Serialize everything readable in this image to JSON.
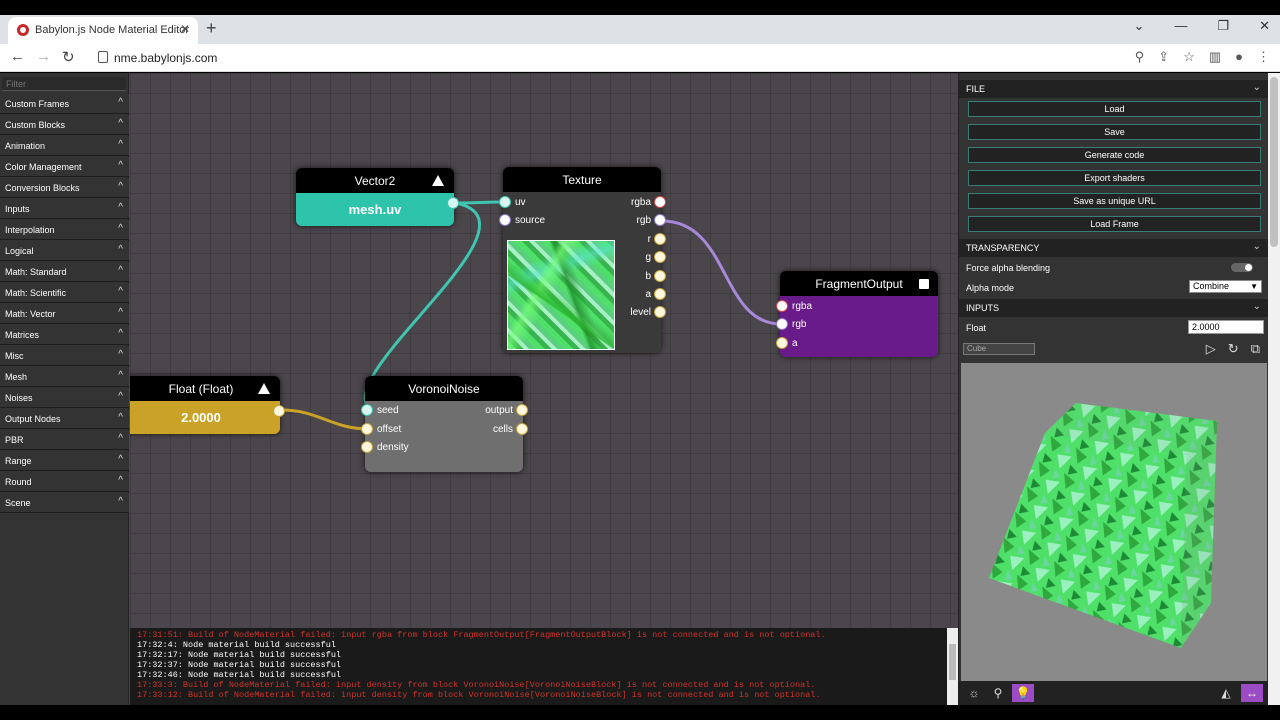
{
  "browser": {
    "tab_title": "Babylon.js Node Material Editor",
    "url": "nme.babylonjs.com",
    "tab_close": "✕",
    "new_tab": "+"
  },
  "left_panel": {
    "filter_placeholder": "Filter",
    "categories": [
      "Custom Frames",
      "Custom Blocks",
      "Animation",
      "Color Management",
      "Conversion Blocks",
      "Inputs",
      "Interpolation",
      "Logical",
      "Math: Standard",
      "Math: Scientific",
      "Math: Vector",
      "Matrices",
      "Misc",
      "Mesh",
      "Noises",
      "Output Nodes",
      "PBR",
      "Range",
      "Round",
      "Scene"
    ]
  },
  "nodes": {
    "vector2": {
      "title": "Vector2",
      "value": "mesh.uv"
    },
    "texture": {
      "title": "Texture",
      "inputs": [
        "uv",
        "source"
      ],
      "outputs": [
        "rgba",
        "rgb",
        "r",
        "g",
        "b",
        "a",
        "level"
      ]
    },
    "fragment_output": {
      "title": "FragmentOutput",
      "inputs": [
        "rgba",
        "rgb",
        "a"
      ]
    },
    "float": {
      "title": "Float (Float)",
      "value": "2.0000"
    },
    "voronoi": {
      "title": "VoronoiNoise",
      "inputs": [
        "seed",
        "offset",
        "density"
      ],
      "outputs": [
        "output",
        "cells"
      ]
    }
  },
  "node_colors": {
    "vector2": "#2ec4ac",
    "texture": "#3a3a3a",
    "fragment_output": "#6a1b8a",
    "float": "#c9a227",
    "voronoi": "#6f6f6f"
  },
  "console": {
    "lines": [
      {
        "text": "17:31:51: Build of NodeMaterial failed: input rgba from block FragmentOutput[FragmentOutputBlock] is not connected and is not optional.",
        "type": "error"
      },
      {
        "text": "17:32:4: Node material build successful",
        "type": "ok"
      },
      {
        "text": "17:32:17: Node material build successful",
        "type": "ok"
      },
      {
        "text": "17:32:37: Node material build successful",
        "type": "ok"
      },
      {
        "text": "17:32:46: Node material build successful",
        "type": "ok"
      },
      {
        "text": "17:33:3: Build of NodeMaterial failed: input density from block VoronoiNoise[VoronoiNoiseBlock] is not connected and is not optional.",
        "type": "error"
      },
      {
        "text": "17:33:12: Build of NodeMaterial failed: input density from block VoronoiNoise[VoronoiNoiseBlock] is not connected and is not optional.",
        "type": "error"
      }
    ]
  },
  "right_panel": {
    "file_header": "FILE",
    "buttons": [
      "Load",
      "Save",
      "Generate code",
      "Export shaders",
      "Save as unique URL",
      "Load Frame"
    ],
    "transparency_header": "TRANSPARENCY",
    "force_alpha_label": "Force alpha blending",
    "alpha_mode_label": "Alpha mode",
    "alpha_mode_value": "Combine",
    "inputs_header": "INPUTS",
    "float_label": "Float",
    "float_value": "2.0000",
    "mesh_select_value": "Cube"
  }
}
